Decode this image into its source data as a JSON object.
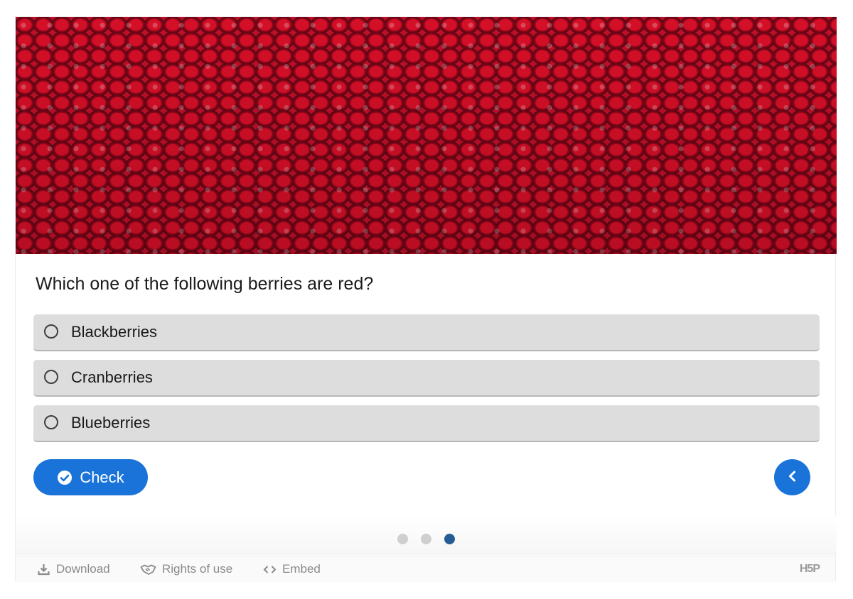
{
  "hero": {
    "icon": "cranberries-photo"
  },
  "question": {
    "text": "Which one of the following berries are red?"
  },
  "answers": [
    {
      "label": "Blackberries"
    },
    {
      "label": "Cranberries"
    },
    {
      "label": "Blueberries"
    }
  ],
  "actions": {
    "check_label": "Check",
    "check_icon": "check-circle-icon",
    "previous_icon": "chevron-left-icon"
  },
  "pager": {
    "total": 3,
    "current": 3
  },
  "footer": {
    "download_label": "Download",
    "rights_label": "Rights of use",
    "embed_label": "Embed",
    "logo_text": "H5P"
  },
  "colors": {
    "accent": "#1a73d9",
    "dot_active": "#255c93",
    "answer_bg": "#dddddd"
  }
}
